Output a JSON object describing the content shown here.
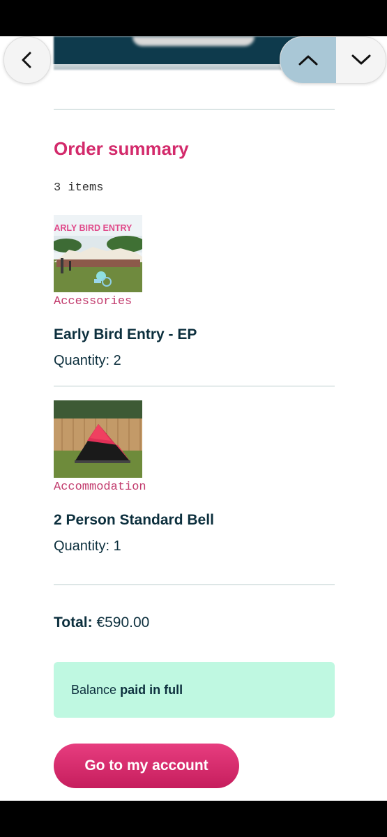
{
  "nav": {
    "back_icon": "chevron-left-icon",
    "up_icon": "chevron-up-icon",
    "down_icon": "chevron-down-icon"
  },
  "order": {
    "heading": "Order summary",
    "items_count": "3 items",
    "items": [
      {
        "image_text": "EARLY BIRD ENTRY",
        "category": "Accessories",
        "name": "Early Bird Entry - EP",
        "quantity": "Quantity: 2"
      },
      {
        "category": "Accommodation",
        "name": "2 Person Standard Bell",
        "quantity": "Quantity: 1"
      }
    ],
    "total_label": "Total:",
    "total_value": "€590.00",
    "balance_prefix": "Balance",
    "balance_status": "paid in full",
    "account_button": "Go to my account"
  },
  "colors": {
    "heading": "#d32a6b",
    "text": "#0c2f3d",
    "category": "#c23b6d",
    "balance_bg": "#bff8e1",
    "button": "#d72a6c"
  }
}
